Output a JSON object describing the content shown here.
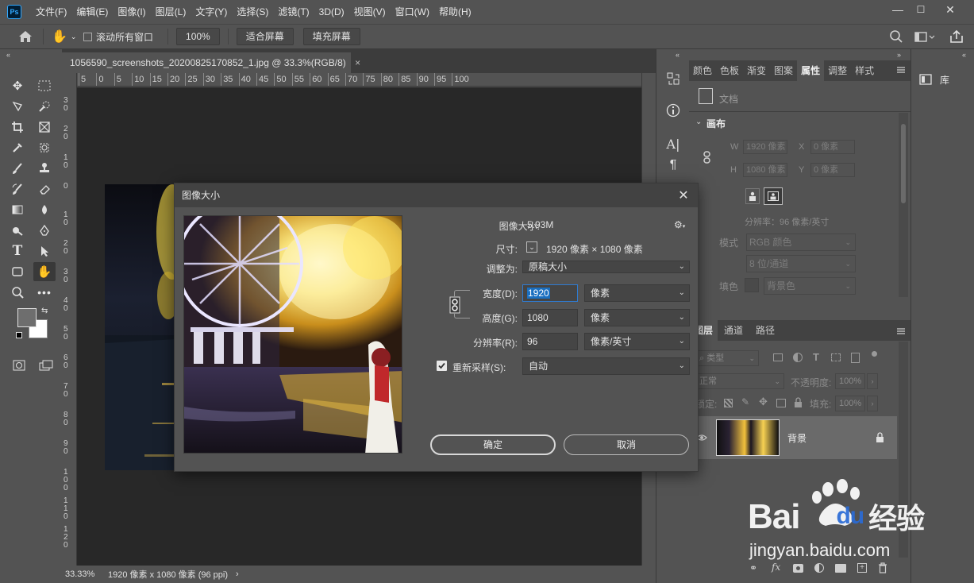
{
  "app": {
    "logo": "Ps"
  },
  "menu": [
    "文件(F)",
    "编辑(E)",
    "图像(I)",
    "图层(L)",
    "文字(Y)",
    "选择(S)",
    "滤镜(T)",
    "3D(D)",
    "视图(V)",
    "窗口(W)",
    "帮助(H)"
  ],
  "window_controls": {
    "minimize": "—",
    "maximize": "☐",
    "close": "✕"
  },
  "options": {
    "scroll_all_label": "滚动所有窗口",
    "zoom_100": "100%",
    "fit_screen": "适合屏幕",
    "fill_screen": "填充屏幕"
  },
  "document": {
    "tab_title": "1056590_screenshots_20200825170852_1.jpg @ 33.3%(RGB/8)",
    "tab_close": "×",
    "ruler_top": [
      "5",
      "0",
      "5",
      "10",
      "15",
      "20",
      "25",
      "30",
      "35",
      "40",
      "45",
      "50",
      "55",
      "60",
      "65",
      "70",
      "75",
      "80",
      "85",
      "90",
      "95",
      "100"
    ],
    "ruler_left": [
      "3 0",
      "2 0",
      "1 0",
      "0",
      "1 0",
      "2 0",
      "3 0",
      "4 0",
      "5 0",
      "6 0",
      "7 0",
      "8 0",
      "9 0",
      "1 0 0",
      "1 1 0",
      "1 2 0"
    ]
  },
  "status": {
    "zoom": "33.33%",
    "info": "1920 像素 x 1080 像素 (96 ppi)",
    "arrow": "›"
  },
  "properties_panel": {
    "tabs": [
      "颜色",
      "色板",
      "渐变",
      "图案",
      "属性",
      "调整",
      "样式"
    ],
    "active_tab": "属性",
    "doc_label": "文档",
    "section": "画布",
    "w_label": "W",
    "w_value": "1920 像素",
    "h_label": "H",
    "h_value": "1080 像素",
    "x_label": "X",
    "x_value": "0 像素",
    "y_label": "Y",
    "y_value": "0 像素",
    "resolution": "分辨率：96 像素/英寸",
    "mode_label": "模式",
    "mode_value": "RGB 颜色",
    "depth_value": "8 位/通道",
    "fill_label": "填色",
    "fill_value": "背景色"
  },
  "layers_panel": {
    "tabs": [
      "图层",
      "通道",
      "路径"
    ],
    "active_tab": "图层",
    "kind_label": "类型",
    "blend_mode": "正常",
    "opacity_label": "不透明度:",
    "opacity_value": "100%",
    "lock_label": "锁定:",
    "fill_label": "填充:",
    "fill_value": "100%",
    "layer_name": "背景"
  },
  "library": {
    "label": "库"
  },
  "dialog": {
    "title": "图像大小",
    "image_size_label": "图像大小:",
    "image_size_value": "5.93M",
    "dimensions_label": "尺寸:",
    "dimensions_value": "1920 像素 × 1080 像素",
    "fit_to_label": "调整为:",
    "fit_to_value": "原稿大小",
    "width_label": "宽度(D):",
    "width_value": "1920",
    "width_unit": "像素",
    "height_label": "高度(G):",
    "height_value": "1080",
    "height_unit": "像素",
    "resolution_label": "分辨率(R):",
    "resolution_value": "96",
    "resolution_unit": "像素/英寸",
    "resample_label": "重新采样(S):",
    "resample_value": "自动",
    "ok_label": "确定",
    "cancel_label": "取消"
  },
  "watermark": {
    "brand": "Bai",
    "du": "du",
    "suffix": "经验",
    "url": "jingyan.baidu.com"
  },
  "colors": {
    "accent": "#31a8ff",
    "panel_bg": "#535353",
    "dark_bg": "#282828",
    "selection": "#1a6fc0"
  }
}
